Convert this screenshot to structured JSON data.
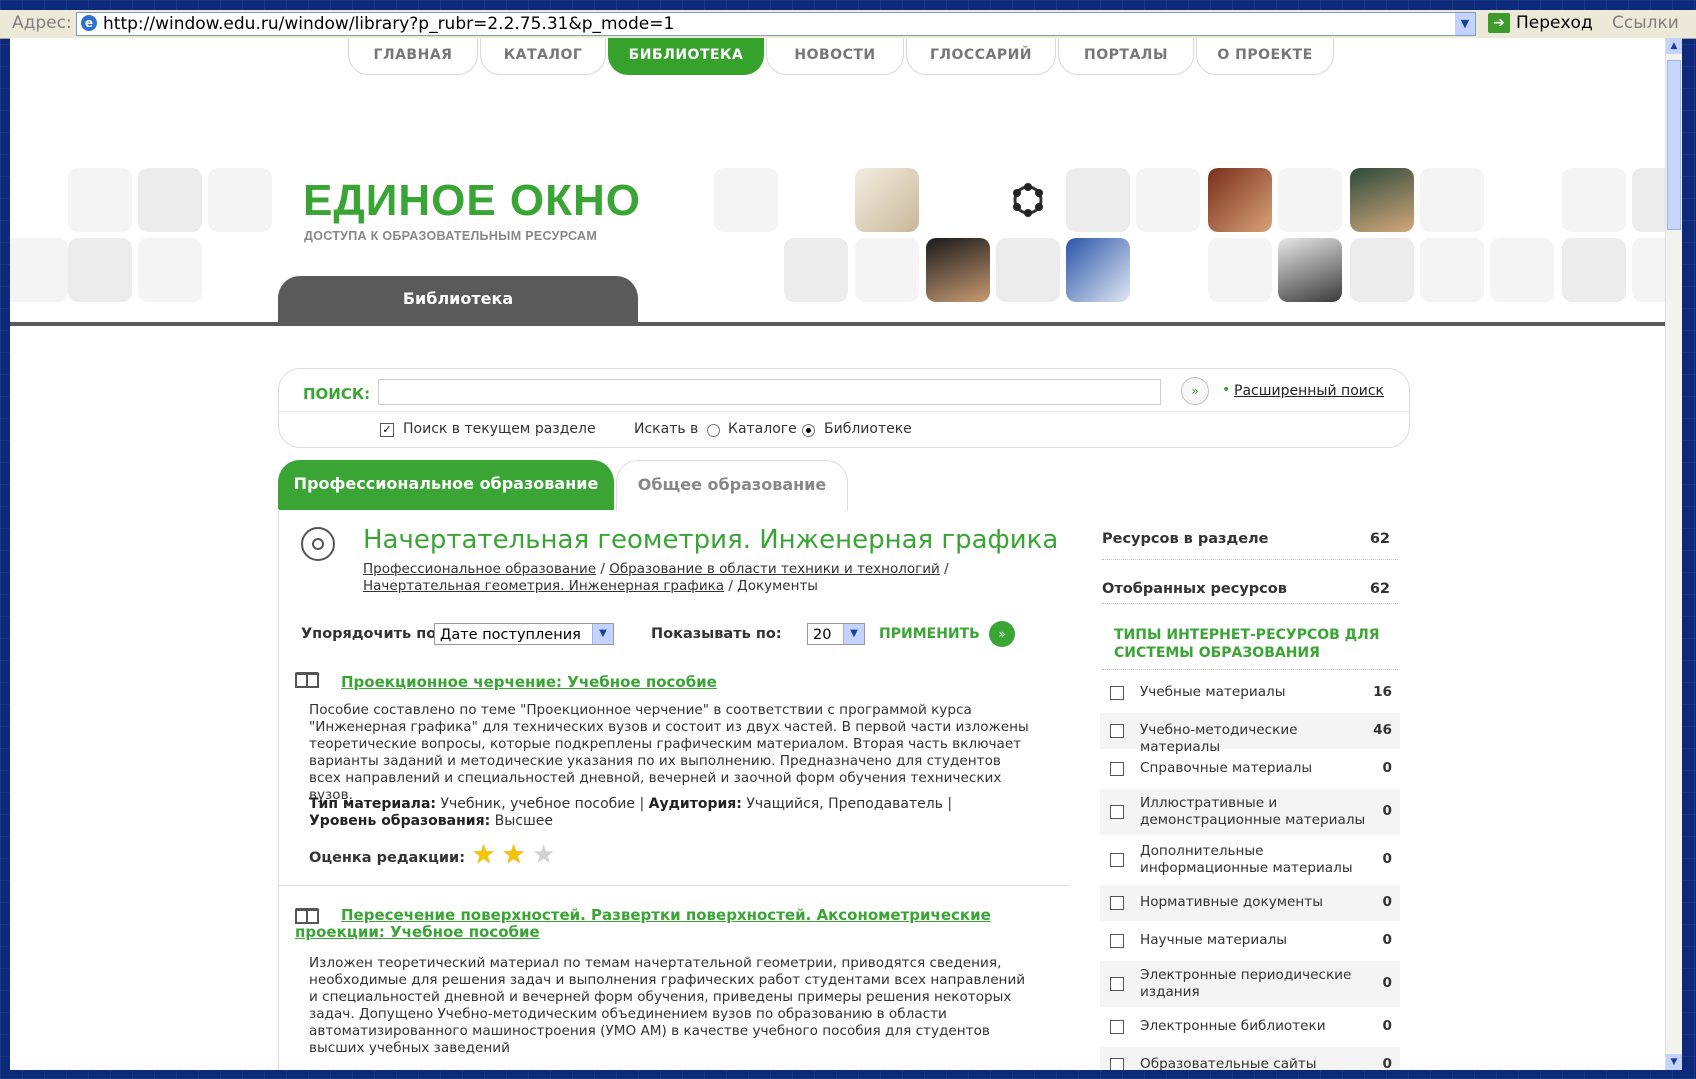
{
  "browser": {
    "address_label": "Адрес:",
    "url": "http://window.edu.ru/window/library?p_rubr=2.2.75.31&p_mode=1",
    "go_label": "Переход",
    "links_label": "Ссылки"
  },
  "nav": {
    "tabs": [
      {
        "label": "ГЛАВНАЯ"
      },
      {
        "label": "КАТАЛОГ"
      },
      {
        "label": "БИБЛИОТЕКА"
      },
      {
        "label": "НОВОСТИ"
      },
      {
        "label": "ГЛОССАРИЙ"
      },
      {
        "label": "ПОРТАЛЫ"
      },
      {
        "label": "О ПРОЕКТЕ"
      }
    ]
  },
  "header": {
    "logo_title": "ЕДИНОЕ ОКНО",
    "logo_subtitle": "ДОСТУПА К ОБРАЗОВАТЕЛЬНЫМ РЕСУРСАМ",
    "section_tab": "Библиотека"
  },
  "search": {
    "label": "ПОИСК:",
    "value": "",
    "advanced": "Расширенный поиск",
    "in_section_label": "Поиск в текущем разделе",
    "search_in_label": "Искать в",
    "catalog_label": "Каталоге",
    "library_label": "Библиотеке"
  },
  "edu_tabs": {
    "professional": "Профессиональное образование",
    "general": "Общее образование"
  },
  "main": {
    "title": "Начертательная геометрия. Инженерная графика",
    "crumbs": {
      "c1": "Профессиональное образование",
      "c2": "Образование в области техники и технологий",
      "c3": "Начертательная геометрия. Инженерная графика",
      "c4": "Документы"
    },
    "sort_label": "Упорядочить по:",
    "sort_value": "Дате поступления",
    "show_label": "Показывать по:",
    "show_value": "20",
    "apply_label": "ПРИМЕНИТЬ"
  },
  "items": [
    {
      "title": "Проекционное черчение: Учебное пособие",
      "desc": "Пособие составлено по теме \"Проекционное черчение\" в соответствии с программой курса \"Инженерная графика\" для технических вузов и состоит из двух частей. В первой части изложены теоретические вопросы, которые подкреплены графическим материалом. Вторая часть включает варианты заданий и методические указания по их выполнению. Предназначено для студентов всех направлений и специальностей дневной, вечерней и заочной форм обучения технических вузов.",
      "type_label": "Тип материала:",
      "type_value": "Учебник, учебное пособие",
      "audience_label": "Аудитория:",
      "audience_value": "Учащийся, Преподаватель",
      "level_label": "Уровень образования:",
      "level_value": "Высшее",
      "rating_label": "Оценка редакции:",
      "rating": 2,
      "rating_max": 3
    },
    {
      "title": "Пересечение поверхностей. Развертки поверхностей. Аксонометрические проекции: Учебное пособие",
      "desc": "Изложен теоретический материал по темам начертательной геометрии, приводятся сведения, необходимые для решения задач и выполнения графических работ студентами всех направлений и специальностей дневной и вечерней форм обучения, приведены примеры решения некоторых задач. Допущено Учебно-методическим объединением вузов по образованию в области автоматизированного машиностроения (УМО АМ) в качестве учебного пособия для студентов высших учебных заведений"
    }
  ],
  "sidebar": {
    "resources_label": "Ресурсов в разделе",
    "resources_count": "62",
    "selected_label": "Отобранных ресурсов",
    "selected_count": "62",
    "types_heading": "ТИПЫ ИНТЕРНЕТ-РЕСУРСОВ ДЛЯ СИСТЕМЫ ОБРАЗОВАНИЯ",
    "filters": [
      {
        "label": "Учебные материалы",
        "count": "16"
      },
      {
        "label": "Учебно-методические материалы",
        "count": "46"
      },
      {
        "label": "Справочные материалы",
        "count": "0"
      },
      {
        "label": "Иллюстративные и демонстрационные материалы",
        "count": "0"
      },
      {
        "label": "Дополнительные информационные материалы",
        "count": "0"
      },
      {
        "label": "Нормативные документы",
        "count": "0"
      },
      {
        "label": "Научные материалы",
        "count": "0"
      },
      {
        "label": "Электронные периодические издания",
        "count": "0"
      },
      {
        "label": "Электронные библиотеки",
        "count": "0"
      },
      {
        "label": "Образовательные сайты",
        "count": "0"
      }
    ]
  },
  "colors": {
    "brand_green": "#3aa535",
    "dark_tab": "#5a5a5a",
    "star": "#f5c400"
  }
}
